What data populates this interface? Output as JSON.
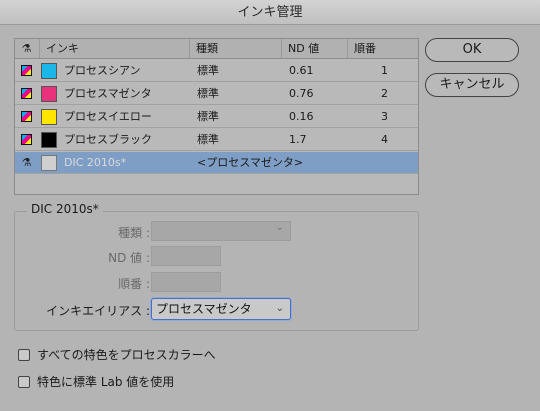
{
  "window": {
    "title": "インキ管理"
  },
  "table": {
    "headers": {
      "ink": "インキ",
      "type": "種類",
      "nd": "ND 値",
      "order": "順番"
    },
    "rows": [
      {
        "name": "プロセスシアン",
        "color": "#1ab7e8",
        "type": "標準",
        "nd": "0.61",
        "order": "1"
      },
      {
        "name": "プロセスマゼンタ",
        "color": "#e8327c",
        "type": "標準",
        "nd": "0.76",
        "order": "2"
      },
      {
        "name": "プロセスイエロー",
        "color": "#ffe600",
        "type": "標準",
        "nd": "0.16",
        "order": "3"
      },
      {
        "name": "プロセスブラック",
        "color": "#000000",
        "type": "標準",
        "nd": "1.7",
        "order": "4"
      }
    ],
    "selected_row": {
      "name": "DIC 2010s*",
      "color": "#cfcfcf",
      "alias": "<プロセスマゼンタ>"
    }
  },
  "buttons": {
    "ok": "OK",
    "cancel": "キャンセル"
  },
  "group": {
    "title": "DIC 2010s*",
    "type_label": "種類 :",
    "nd_label": "ND 値 :",
    "order_label": "順番 :",
    "alias_label": "インキエイリアス :",
    "alias_value": "プロセスマゼンタ"
  },
  "checkboxes": {
    "all_to_process": "すべての特色をプロセスカラーへ",
    "use_lab": "特色に標準 Lab 値を使用"
  },
  "icons": {
    "process": "process-ink-icon",
    "spot": "spot-ink-flask-icon",
    "dropdown": "chevron-down-icon"
  }
}
